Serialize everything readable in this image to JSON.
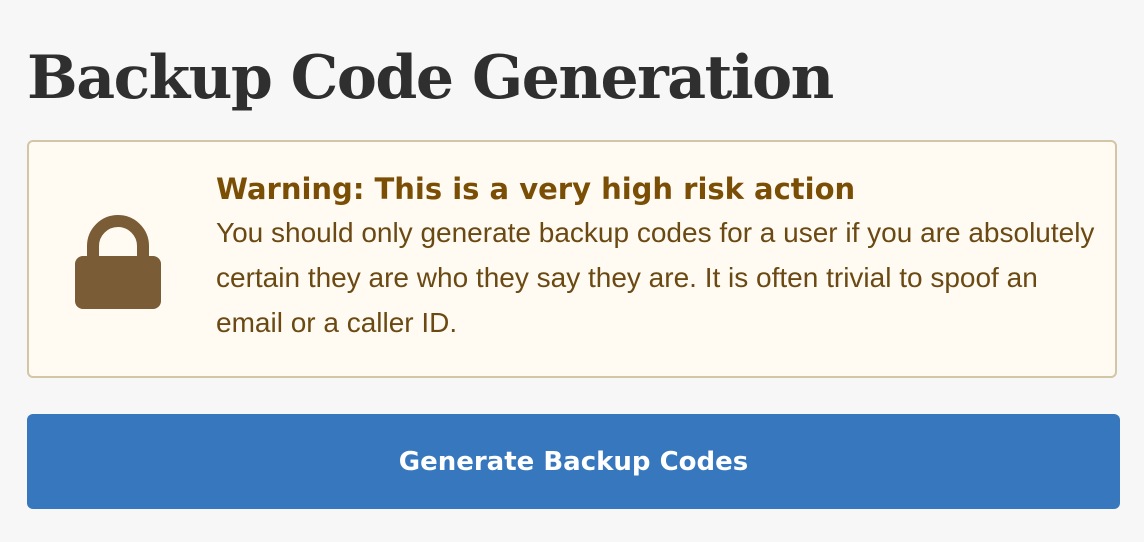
{
  "page": {
    "title": "Backup Code Generation"
  },
  "warning": {
    "icon": "lock-icon",
    "heading": "Warning: This is a very high risk action",
    "body": "You should only generate backup codes for a user if you are absolutely certain they are who they say they are. It is often trivial to spoof an email or a caller ID."
  },
  "actions": {
    "generate_label": "Generate Backup Codes"
  },
  "colors": {
    "accent": "#3677bd",
    "warning_text": "#7a4f05",
    "warning_background": "#fffaf2",
    "warning_border": "#d3c6a6",
    "lock_icon": "#7a5c36"
  }
}
